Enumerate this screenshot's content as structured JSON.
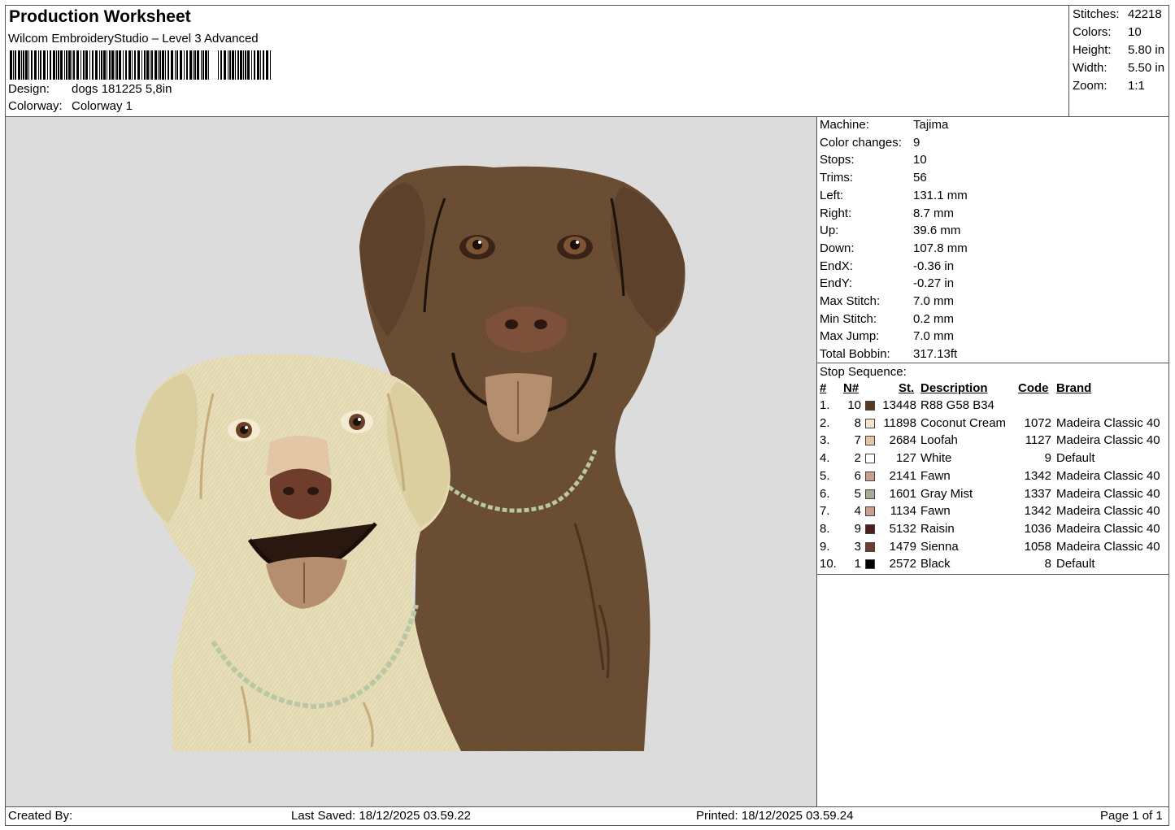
{
  "header": {
    "title": "Production Worksheet",
    "subtitle": "Wilcom EmbroideryStudio – Level 3 Advanced",
    "design_label": "Design:",
    "design_value": "dogs 181225 5,8in",
    "colorway_label": "Colorway:",
    "colorway_value": "Colorway 1"
  },
  "summary": [
    {
      "label": "Stitches:",
      "value": "42218"
    },
    {
      "label": "Colors:",
      "value": "10"
    },
    {
      "label": "Height:",
      "value": "5.80 in"
    },
    {
      "label": "Width:",
      "value": "5.50 in"
    },
    {
      "label": "Zoom:",
      "value": "1:1"
    }
  ],
  "specs": [
    {
      "label": "Machine:",
      "value": "Tajima"
    },
    {
      "label": "Color changes:",
      "value": "9"
    },
    {
      "label": "Stops:",
      "value": "10"
    },
    {
      "label": "Trims:",
      "value": "56"
    },
    {
      "label": "Left:",
      "value": "131.1 mm"
    },
    {
      "label": "Right:",
      "value": "8.7 mm"
    },
    {
      "label": "Up:",
      "value": "39.6 mm"
    },
    {
      "label": "Down:",
      "value": "107.8 mm"
    },
    {
      "label": "EndX:",
      "value": "-0.36 in"
    },
    {
      "label": "EndY:",
      "value": "-0.27 in"
    },
    {
      "label": "Max Stitch:",
      "value": "7.0 mm"
    },
    {
      "label": "Min Stitch:",
      "value": "0.2 mm"
    },
    {
      "label": "Max Jump:",
      "value": "7.0 mm"
    },
    {
      "label": "Total Bobbin:",
      "value": "317.13ft"
    }
  ],
  "stop_sequence": {
    "title": "Stop Sequence:",
    "headers": {
      "num": "#",
      "n": "N#",
      "st": "St.",
      "desc": "Description",
      "code": "Code",
      "brand": "Brand"
    },
    "rows": [
      {
        "num": "1.",
        "n": "10",
        "st": "13448",
        "desc": "R88 G58 B34",
        "code": "",
        "brand": "",
        "color": "#583a22"
      },
      {
        "num": "2.",
        "n": "8",
        "st": "11898",
        "desc": "Coconut Cream",
        "code": "1072",
        "brand": "Madeira Classic 40",
        "color": "#f3e4cc"
      },
      {
        "num": "3.",
        "n": "7",
        "st": "2684",
        "desc": "Loofah",
        "code": "1127",
        "brand": "Madeira Classic 40",
        "color": "#e2c6a6"
      },
      {
        "num": "4.",
        "n": "2",
        "st": "127",
        "desc": "White",
        "code": "9",
        "brand": "Default",
        "color": "#ffffff"
      },
      {
        "num": "5.",
        "n": "6",
        "st": "2141",
        "desc": "Fawn",
        "code": "1342",
        "brand": "Madeira Classic 40",
        "color": "#c7a18a"
      },
      {
        "num": "6.",
        "n": "5",
        "st": "1601",
        "desc": "Gray Mist",
        "code": "1337",
        "brand": "Madeira Classic 40",
        "color": "#a8aa98"
      },
      {
        "num": "7.",
        "n": "4",
        "st": "1134",
        "desc": "Fawn",
        "code": "1342",
        "brand": "Madeira Classic 40",
        "color": "#c7a18a"
      },
      {
        "num": "8.",
        "n": "9",
        "st": "5132",
        "desc": "Raisin",
        "code": "1036",
        "brand": "Madeira Classic 40",
        "color": "#4a1f1e"
      },
      {
        "num": "9.",
        "n": "3",
        "st": "1479",
        "desc": "Sienna",
        "code": "1058",
        "brand": "Madeira Classic 40",
        "color": "#6e3d2b"
      },
      {
        "num": "10.",
        "n": "1",
        "st": "2572",
        "desc": "Black",
        "code": "8",
        "brand": "Default",
        "color": "#000000"
      }
    ]
  },
  "footer": {
    "created_by": "Created By:",
    "last_saved": "Last Saved: 18/12/2025 03.59.22",
    "printed": "Printed: 18/12/2025 03.59.24",
    "page": "Page 1 of 1"
  },
  "colors": {
    "preview_bg": "#dcdcdc",
    "yellow_lab": "#e7ddb6",
    "chocolate_lab": "#6b4e33",
    "collar": "#b9c7a4"
  }
}
